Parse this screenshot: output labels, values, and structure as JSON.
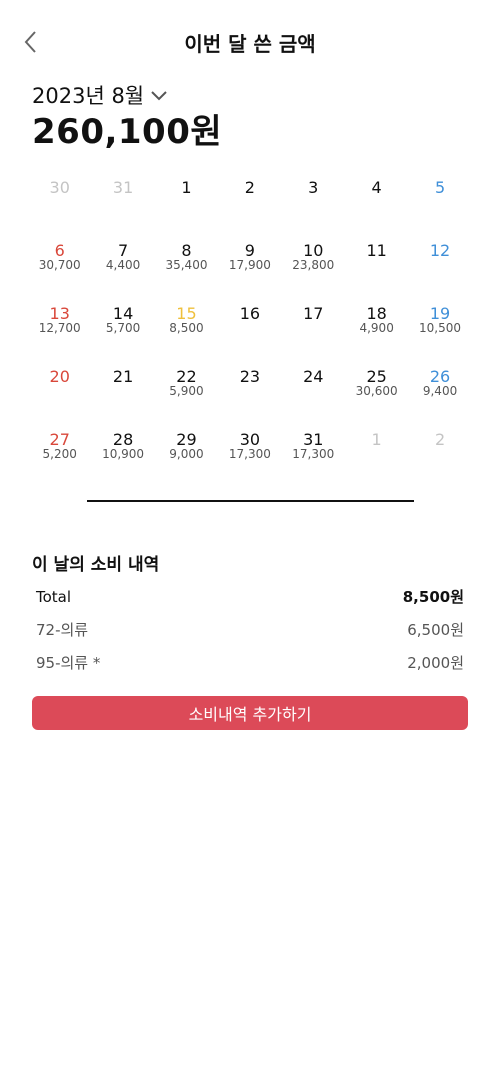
{
  "header": {
    "title": "이번 달 쓴 금액"
  },
  "summary": {
    "month": "2023년 8월",
    "total": "260,100원"
  },
  "calendar": {
    "weeks": [
      [
        {
          "n": "30",
          "a": "",
          "t": "other"
        },
        {
          "n": "31",
          "a": "",
          "t": "other"
        },
        {
          "n": "1",
          "a": "",
          "t": ""
        },
        {
          "n": "2",
          "a": "",
          "t": ""
        },
        {
          "n": "3",
          "a": "",
          "t": ""
        },
        {
          "n": "4",
          "a": "",
          "t": ""
        },
        {
          "n": "5",
          "a": "",
          "t": "sat"
        }
      ],
      [
        {
          "n": "6",
          "a": "30,700",
          "t": "sun"
        },
        {
          "n": "7",
          "a": "4,400",
          "t": ""
        },
        {
          "n": "8",
          "a": "35,400",
          "t": ""
        },
        {
          "n": "9",
          "a": "17,900",
          "t": ""
        },
        {
          "n": "10",
          "a": "23,800",
          "t": ""
        },
        {
          "n": "11",
          "a": "",
          "t": ""
        },
        {
          "n": "12",
          "a": "",
          "t": "sat"
        }
      ],
      [
        {
          "n": "13",
          "a": "12,700",
          "t": "sun"
        },
        {
          "n": "14",
          "a": "5,700",
          "t": ""
        },
        {
          "n": "15",
          "a": "8,500",
          "t": "selected"
        },
        {
          "n": "16",
          "a": "",
          "t": ""
        },
        {
          "n": "17",
          "a": "",
          "t": ""
        },
        {
          "n": "18",
          "a": "4,900",
          "t": ""
        },
        {
          "n": "19",
          "a": "10,500",
          "t": "sat"
        }
      ],
      [
        {
          "n": "20",
          "a": "",
          "t": "sun"
        },
        {
          "n": "21",
          "a": "",
          "t": ""
        },
        {
          "n": "22",
          "a": "5,900",
          "t": ""
        },
        {
          "n": "23",
          "a": "",
          "t": ""
        },
        {
          "n": "24",
          "a": "",
          "t": ""
        },
        {
          "n": "25",
          "a": "30,600",
          "t": ""
        },
        {
          "n": "26",
          "a": "9,400",
          "t": "sat"
        }
      ],
      [
        {
          "n": "27",
          "a": "5,200",
          "t": "sun"
        },
        {
          "n": "28",
          "a": "10,900",
          "t": ""
        },
        {
          "n": "29",
          "a": "9,000",
          "t": ""
        },
        {
          "n": "30",
          "a": "17,300",
          "t": ""
        },
        {
          "n": "31",
          "a": "17,300",
          "t": ""
        },
        {
          "n": "1",
          "a": "",
          "t": "other"
        },
        {
          "n": "2",
          "a": "",
          "t": "other"
        }
      ]
    ]
  },
  "details": {
    "title": "이 날의 소비 내역",
    "rows": [
      {
        "label": "Total",
        "amount": "8,500원"
      },
      {
        "label": "72-의류",
        "amount": "6,500원"
      },
      {
        "label": "95-의류 *",
        "amount": "2,000원"
      }
    ],
    "add_label": "소비내역 추가하기"
  },
  "colors": {
    "sunday": "#d9483b",
    "saturday": "#3f8fd8",
    "selected": "#efc03c",
    "accent_button": "#dc4a58"
  },
  "icons": {
    "back": "chevron-left-icon",
    "dropdown": "chevron-down-icon"
  }
}
